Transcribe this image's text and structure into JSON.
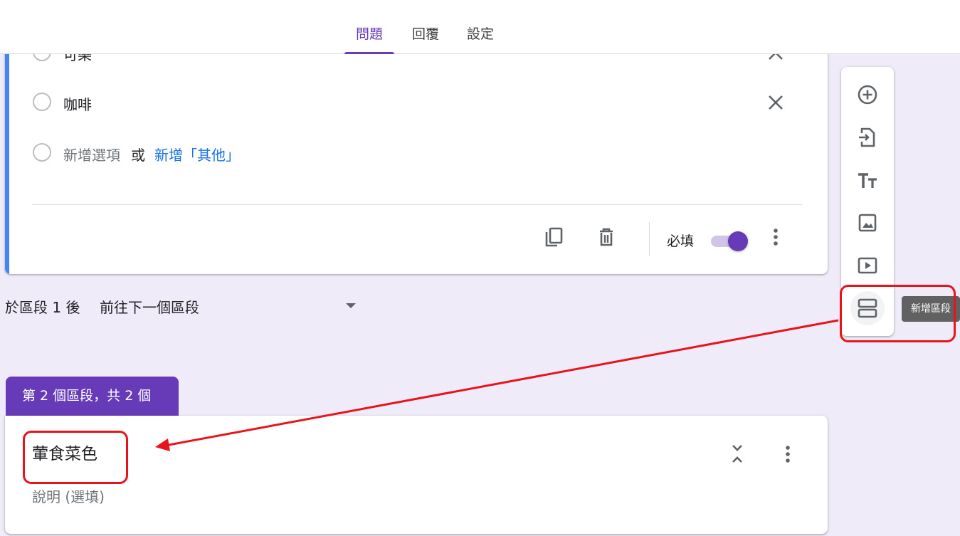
{
  "tabs": [
    {
      "label": "問題",
      "active": true
    },
    {
      "label": "回覆",
      "active": false
    },
    {
      "label": "設定",
      "active": false
    }
  ],
  "question": {
    "partial_option": "可樂",
    "options": [
      {
        "label": "咖啡"
      }
    ],
    "add_option": "新增選項",
    "or_word": "或",
    "add_other": "新增「其他」",
    "required_label": "必填",
    "required_on": true
  },
  "after_section": {
    "label": "於區段 1 後",
    "selected": "前往下一個區段"
  },
  "section": {
    "tab_label": "第 2 個區段，共 2 個",
    "title": "葷食菜色",
    "description_placeholder": "說明 (選填)"
  },
  "toolbar": {
    "tooltip": "新增區段",
    "buttons": [
      "add-question-icon",
      "import-questions-icon",
      "add-title-icon",
      "add-image-icon",
      "add-video-icon",
      "add-section-icon"
    ]
  },
  "colors": {
    "accent": "#673ab7",
    "question_bar": "#4285f4",
    "link": "#1a73e8",
    "annotation": "#e8141c"
  }
}
